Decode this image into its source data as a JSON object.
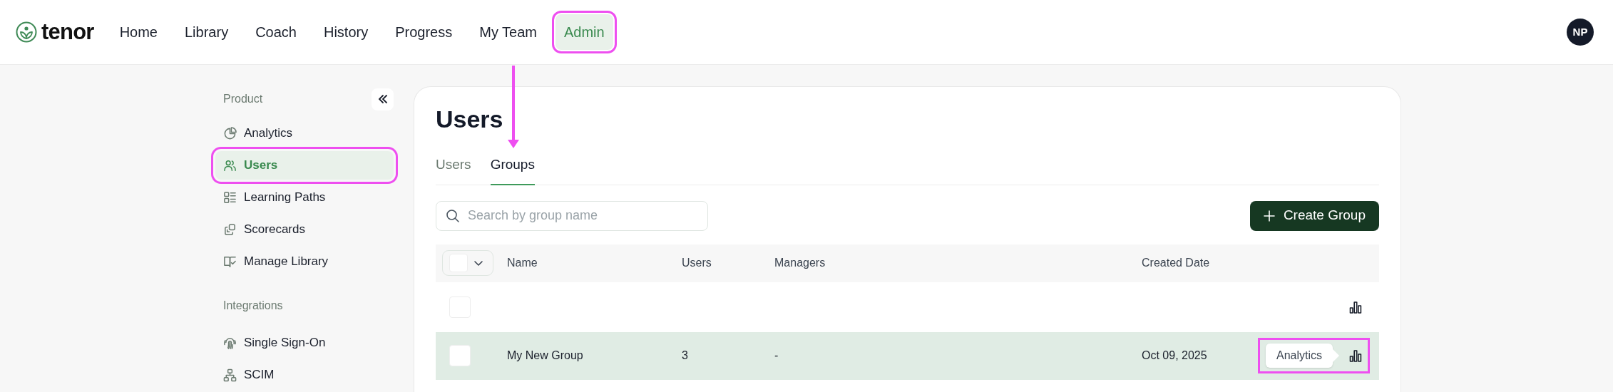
{
  "nav": {
    "brand": "tenor",
    "items": [
      {
        "label": "Home",
        "selected": false,
        "highlighted": false
      },
      {
        "label": "Library",
        "selected": false,
        "highlighted": false
      },
      {
        "label": "Coach",
        "selected": false,
        "highlighted": false
      },
      {
        "label": "History",
        "selected": false,
        "highlighted": false
      },
      {
        "label": "Progress",
        "selected": false,
        "highlighted": false
      },
      {
        "label": "My Team",
        "selected": false,
        "highlighted": false
      },
      {
        "label": "Admin",
        "selected": true,
        "highlighted": true
      }
    ],
    "avatar": "NP"
  },
  "sidebar": {
    "sections": [
      {
        "title": "Product",
        "items": [
          {
            "label": "Analytics",
            "kind": "pie",
            "selected": false,
            "highlighted": false
          },
          {
            "label": "Users",
            "kind": "users",
            "selected": true,
            "highlighted": true
          },
          {
            "label": "Learning Paths",
            "kind": "list",
            "selected": false,
            "highlighted": false
          },
          {
            "label": "Scorecards",
            "kind": "cards",
            "selected": false,
            "highlighted": false
          },
          {
            "label": "Manage Library",
            "kind": "book",
            "selected": false,
            "highlighted": false
          }
        ]
      },
      {
        "title": "Integrations",
        "items": [
          {
            "label": "Single Sign-On",
            "kind": "fingerprint",
            "selected": false,
            "highlighted": false
          },
          {
            "label": "SCIM",
            "kind": "network",
            "selected": false,
            "highlighted": false
          }
        ]
      }
    ]
  },
  "page": {
    "title": "Users",
    "tabs": [
      {
        "label": "Users",
        "selected": false
      },
      {
        "label": "Groups",
        "selected": true
      }
    ],
    "search": {
      "placeholder": "Search by group name"
    },
    "create_button": "Create Group",
    "table": {
      "columns": [
        "Name",
        "Users",
        "Managers",
        "Created Date"
      ],
      "rows": [
        {
          "name": "",
          "users": "",
          "managers": "",
          "created": "",
          "checked": false,
          "selected": false
        },
        {
          "name": "My New Group",
          "users": "3",
          "managers": "-",
          "created": "Oct 09, 2025",
          "checked": false,
          "selected": true,
          "tooltip": "Analytics",
          "highlighted": true
        }
      ]
    }
  }
}
